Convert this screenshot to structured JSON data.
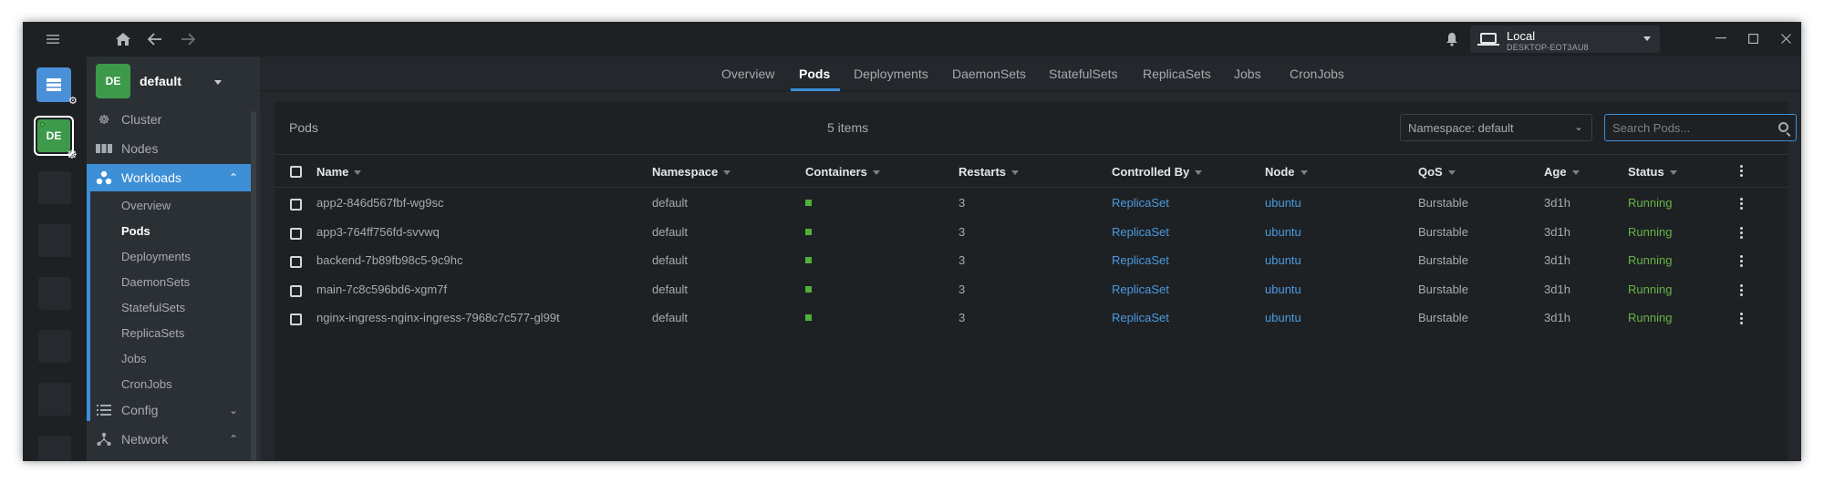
{
  "colors": {
    "accent": "#3d8fd6",
    "running": "#66b545",
    "link": "#4a9ae0",
    "namespace_badge": "#3d9a4a"
  },
  "titlebar": {
    "menu_icon": "hamburger-icon",
    "home_icon": "home-icon",
    "back_icon": "arrow-left-icon",
    "forward_icon": "arrow-right-icon",
    "notification_icon": "bell-icon",
    "cluster": {
      "name": "Local",
      "host": "DESKTOP-EOT3AU8"
    }
  },
  "hotbar": {
    "cluster_badge": "DE"
  },
  "sidebar": {
    "namespace": {
      "badge": "DE",
      "name": "default"
    },
    "items": [
      {
        "label": "Cluster",
        "icon": "helm-wheel-icon"
      },
      {
        "label": "Nodes",
        "icon": "nodes-icon"
      },
      {
        "label": "Workloads",
        "icon": "workloads-icon"
      },
      {
        "label": "Config",
        "icon": "list-icon"
      },
      {
        "label": "Network",
        "icon": "network-icon"
      }
    ],
    "workloads_sub": [
      "Overview",
      "Pods",
      "Deployments",
      "DaemonSets",
      "StatefulSets",
      "ReplicaSets",
      "Jobs",
      "CronJobs"
    ]
  },
  "tabs": [
    "Overview",
    "Pods",
    "Deployments",
    "DaemonSets",
    "StatefulSets",
    "ReplicaSets",
    "Jobs",
    "CronJobs"
  ],
  "panel": {
    "title": "Pods",
    "count": "5 items",
    "namespace_filter": "Namespace: default",
    "search_placeholder": "Search Pods..."
  },
  "table": {
    "columns": [
      "Name",
      "Namespace",
      "Containers",
      "Restarts",
      "Controlled By",
      "Node",
      "QoS",
      "Age",
      "Status"
    ],
    "rows": [
      {
        "name": "app2-846d567fbf-wg9sc",
        "namespace": "default",
        "restarts": "3",
        "controlled_by": "ReplicaSet",
        "node": "ubuntu",
        "qos": "Burstable",
        "age": "3d1h",
        "status": "Running"
      },
      {
        "name": "app3-764ff756fd-svvwq",
        "namespace": "default",
        "restarts": "3",
        "controlled_by": "ReplicaSet",
        "node": "ubuntu",
        "qos": "Burstable",
        "age": "3d1h",
        "status": "Running"
      },
      {
        "name": "backend-7b89fb98c5-9c9hc",
        "namespace": "default",
        "restarts": "3",
        "controlled_by": "ReplicaSet",
        "node": "ubuntu",
        "qos": "Burstable",
        "age": "3d1h",
        "status": "Running"
      },
      {
        "name": "main-7c8c596bd6-xgm7f",
        "namespace": "default",
        "restarts": "3",
        "controlled_by": "ReplicaSet",
        "node": "ubuntu",
        "qos": "Burstable",
        "age": "3d1h",
        "status": "Running"
      },
      {
        "name": "nginx-ingress-nginx-ingress-7968c7c577-gl99t",
        "namespace": "default",
        "restarts": "3",
        "controlled_by": "ReplicaSet",
        "node": "ubuntu",
        "qos": "Burstable",
        "age": "3d1h",
        "status": "Running"
      }
    ]
  }
}
